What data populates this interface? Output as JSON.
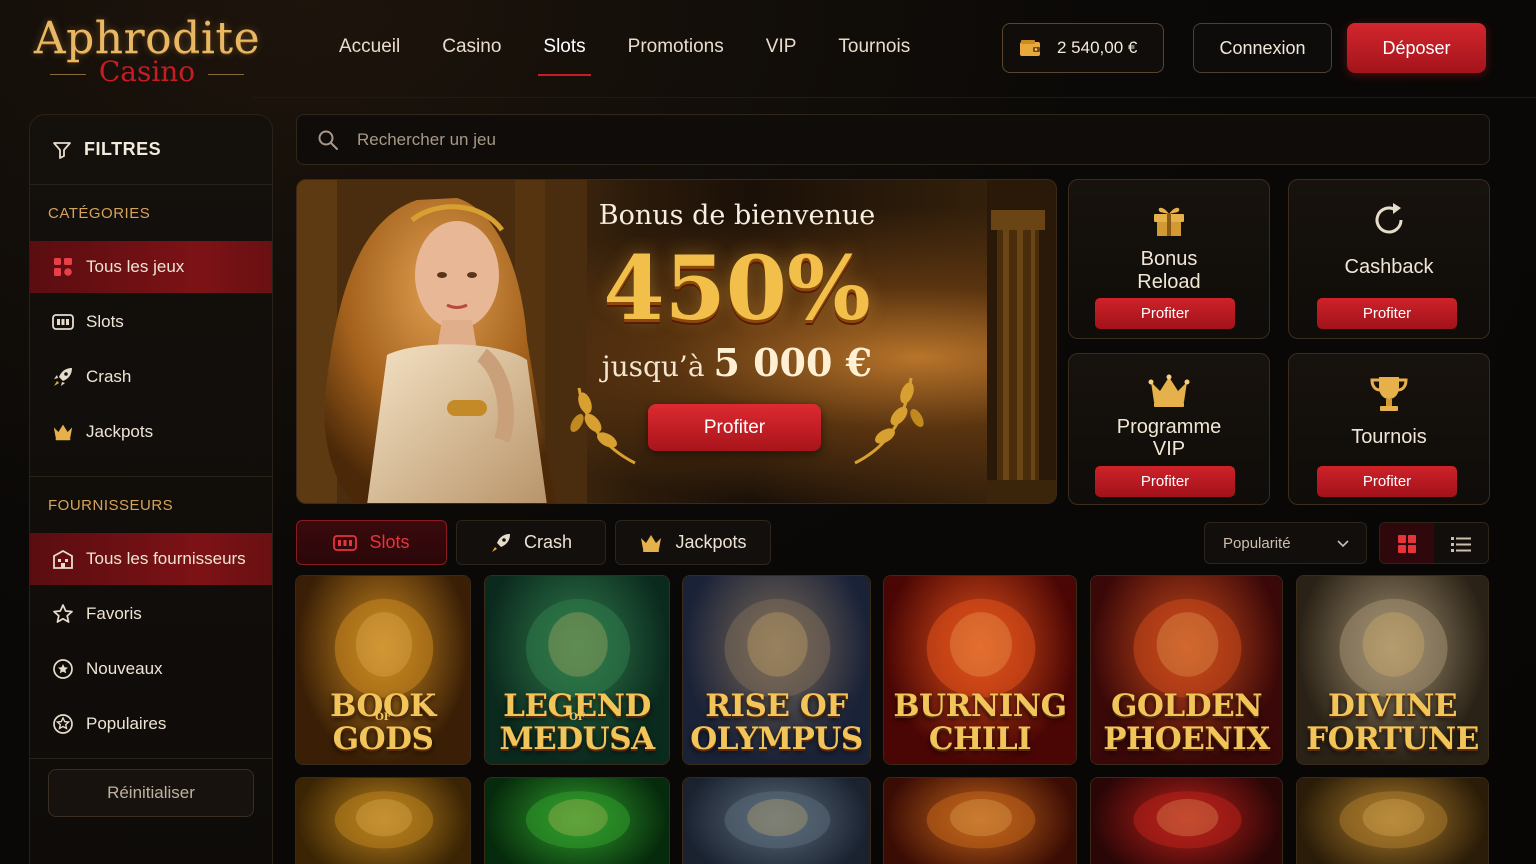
{
  "brand": {
    "name": "Aphrodite",
    "subtitle": "Casino"
  },
  "nav": [
    {
      "label": "Accueil",
      "active": false
    },
    {
      "label": "Casino",
      "active": false
    },
    {
      "label": "Slots",
      "active": true
    },
    {
      "label": "Promotions",
      "active": false
    },
    {
      "label": "VIP",
      "active": false
    },
    {
      "label": "Tournois",
      "active": false
    }
  ],
  "header": {
    "balance": "2 540,00 €",
    "login_label": "Connexion",
    "deposit_label": "Déposer"
  },
  "sidebar": {
    "filters_label": "FILTRES",
    "categories_heading": "CATÉGORIES",
    "categories": [
      {
        "label": "Tous les jeux",
        "icon": "grid-icon",
        "active": true
      },
      {
        "label": "Slots",
        "icon": "slot-machine-icon",
        "active": false
      },
      {
        "label": "Crash",
        "icon": "rocket-icon",
        "active": false
      },
      {
        "label": "Jackpots",
        "icon": "crown-icon",
        "active": false
      }
    ],
    "providers_heading": "FOURNISSEURS",
    "providers": [
      {
        "label": "Tous les fournisseurs",
        "icon": "building-icon",
        "active": true
      },
      {
        "label": "Favoris",
        "icon": "star-icon",
        "active": false
      },
      {
        "label": "Nouveaux",
        "icon": "new-badge-icon",
        "active": false
      },
      {
        "label": "Populaires",
        "icon": "popular-star-icon",
        "active": false
      }
    ],
    "reset_label": "Réinitialiser"
  },
  "search": {
    "placeholder": "Rechercher un jeu",
    "value": ""
  },
  "hero": {
    "title": "Bonus de bienvenue",
    "percent": "450%",
    "upto_prefix": "jusqu’à",
    "upto_amount": "5 000 €",
    "cta": "Profiter"
  },
  "promos": [
    {
      "title": "Bonus\nReload",
      "icon": "gift-icon",
      "cta": "Profiter"
    },
    {
      "title": "Cashback",
      "icon": "refresh-icon",
      "cta": "Profiter"
    },
    {
      "title": "Programme\nVIP",
      "icon": "crown-icon",
      "cta": "Profiter"
    },
    {
      "title": "Tournois",
      "icon": "trophy-icon",
      "cta": "Profiter"
    }
  ],
  "tabs": [
    {
      "label": "Slots",
      "icon": "slot-machine-icon",
      "active": true
    },
    {
      "label": "Crash",
      "icon": "rocket-icon",
      "active": false
    },
    {
      "label": "Jackpots",
      "icon": "crown-icon",
      "active": false
    }
  ],
  "sort": {
    "selected": "Popularité"
  },
  "view": {
    "grid_active": true
  },
  "games": [
    {
      "name": "BOOK\nGODS",
      "of": "OF",
      "theme": "book",
      "colors": [
        "#3a1f06",
        "#c8861f"
      ]
    },
    {
      "name": "LEGEND\nMEDUSA",
      "of": "OF",
      "theme": "medusa",
      "colors": [
        "#0b2a1e",
        "#2f7a4a"
      ]
    },
    {
      "name": "RISE OF\nOLYMPUS",
      "of": "",
      "theme": "zeus",
      "colors": [
        "#1a2238",
        "#7a6a58"
      ]
    },
    {
      "name": "BURNING\nCHILI",
      "of": "",
      "theme": "chili",
      "colors": [
        "#4a0604",
        "#e0501a"
      ]
    },
    {
      "name": "GOLDEN\nPHOENIX",
      "of": "",
      "theme": "phoenix",
      "colors": [
        "#3a0808",
        "#c8481a"
      ]
    },
    {
      "name": "DIVINE\nFORTUNE",
      "of": "",
      "theme": "pegasus",
      "colors": [
        "#2a2216",
        "#a08e70"
      ]
    },
    {
      "name": "",
      "of": "",
      "theme": "aztec",
      "colors": [
        "#3a2404",
        "#b8801c"
      ]
    },
    {
      "name": "",
      "of": "",
      "theme": "clover",
      "colors": [
        "#062a0c",
        "#2f9a2a"
      ]
    },
    {
      "name": "",
      "of": "",
      "theme": "viking",
      "colors": [
        "#1a2230",
        "#5a6a78"
      ]
    },
    {
      "name": "",
      "of": "",
      "theme": "dragon",
      "colors": [
        "#3a0c04",
        "#c0621a"
      ]
    },
    {
      "name": "",
      "of": "",
      "theme": "lucky7",
      "colors": [
        "#2a0606",
        "#b8201a"
      ]
    },
    {
      "name": "",
      "of": "",
      "theme": "cleopatra",
      "colors": [
        "#2a1c08",
        "#a8782a"
      ]
    }
  ]
}
